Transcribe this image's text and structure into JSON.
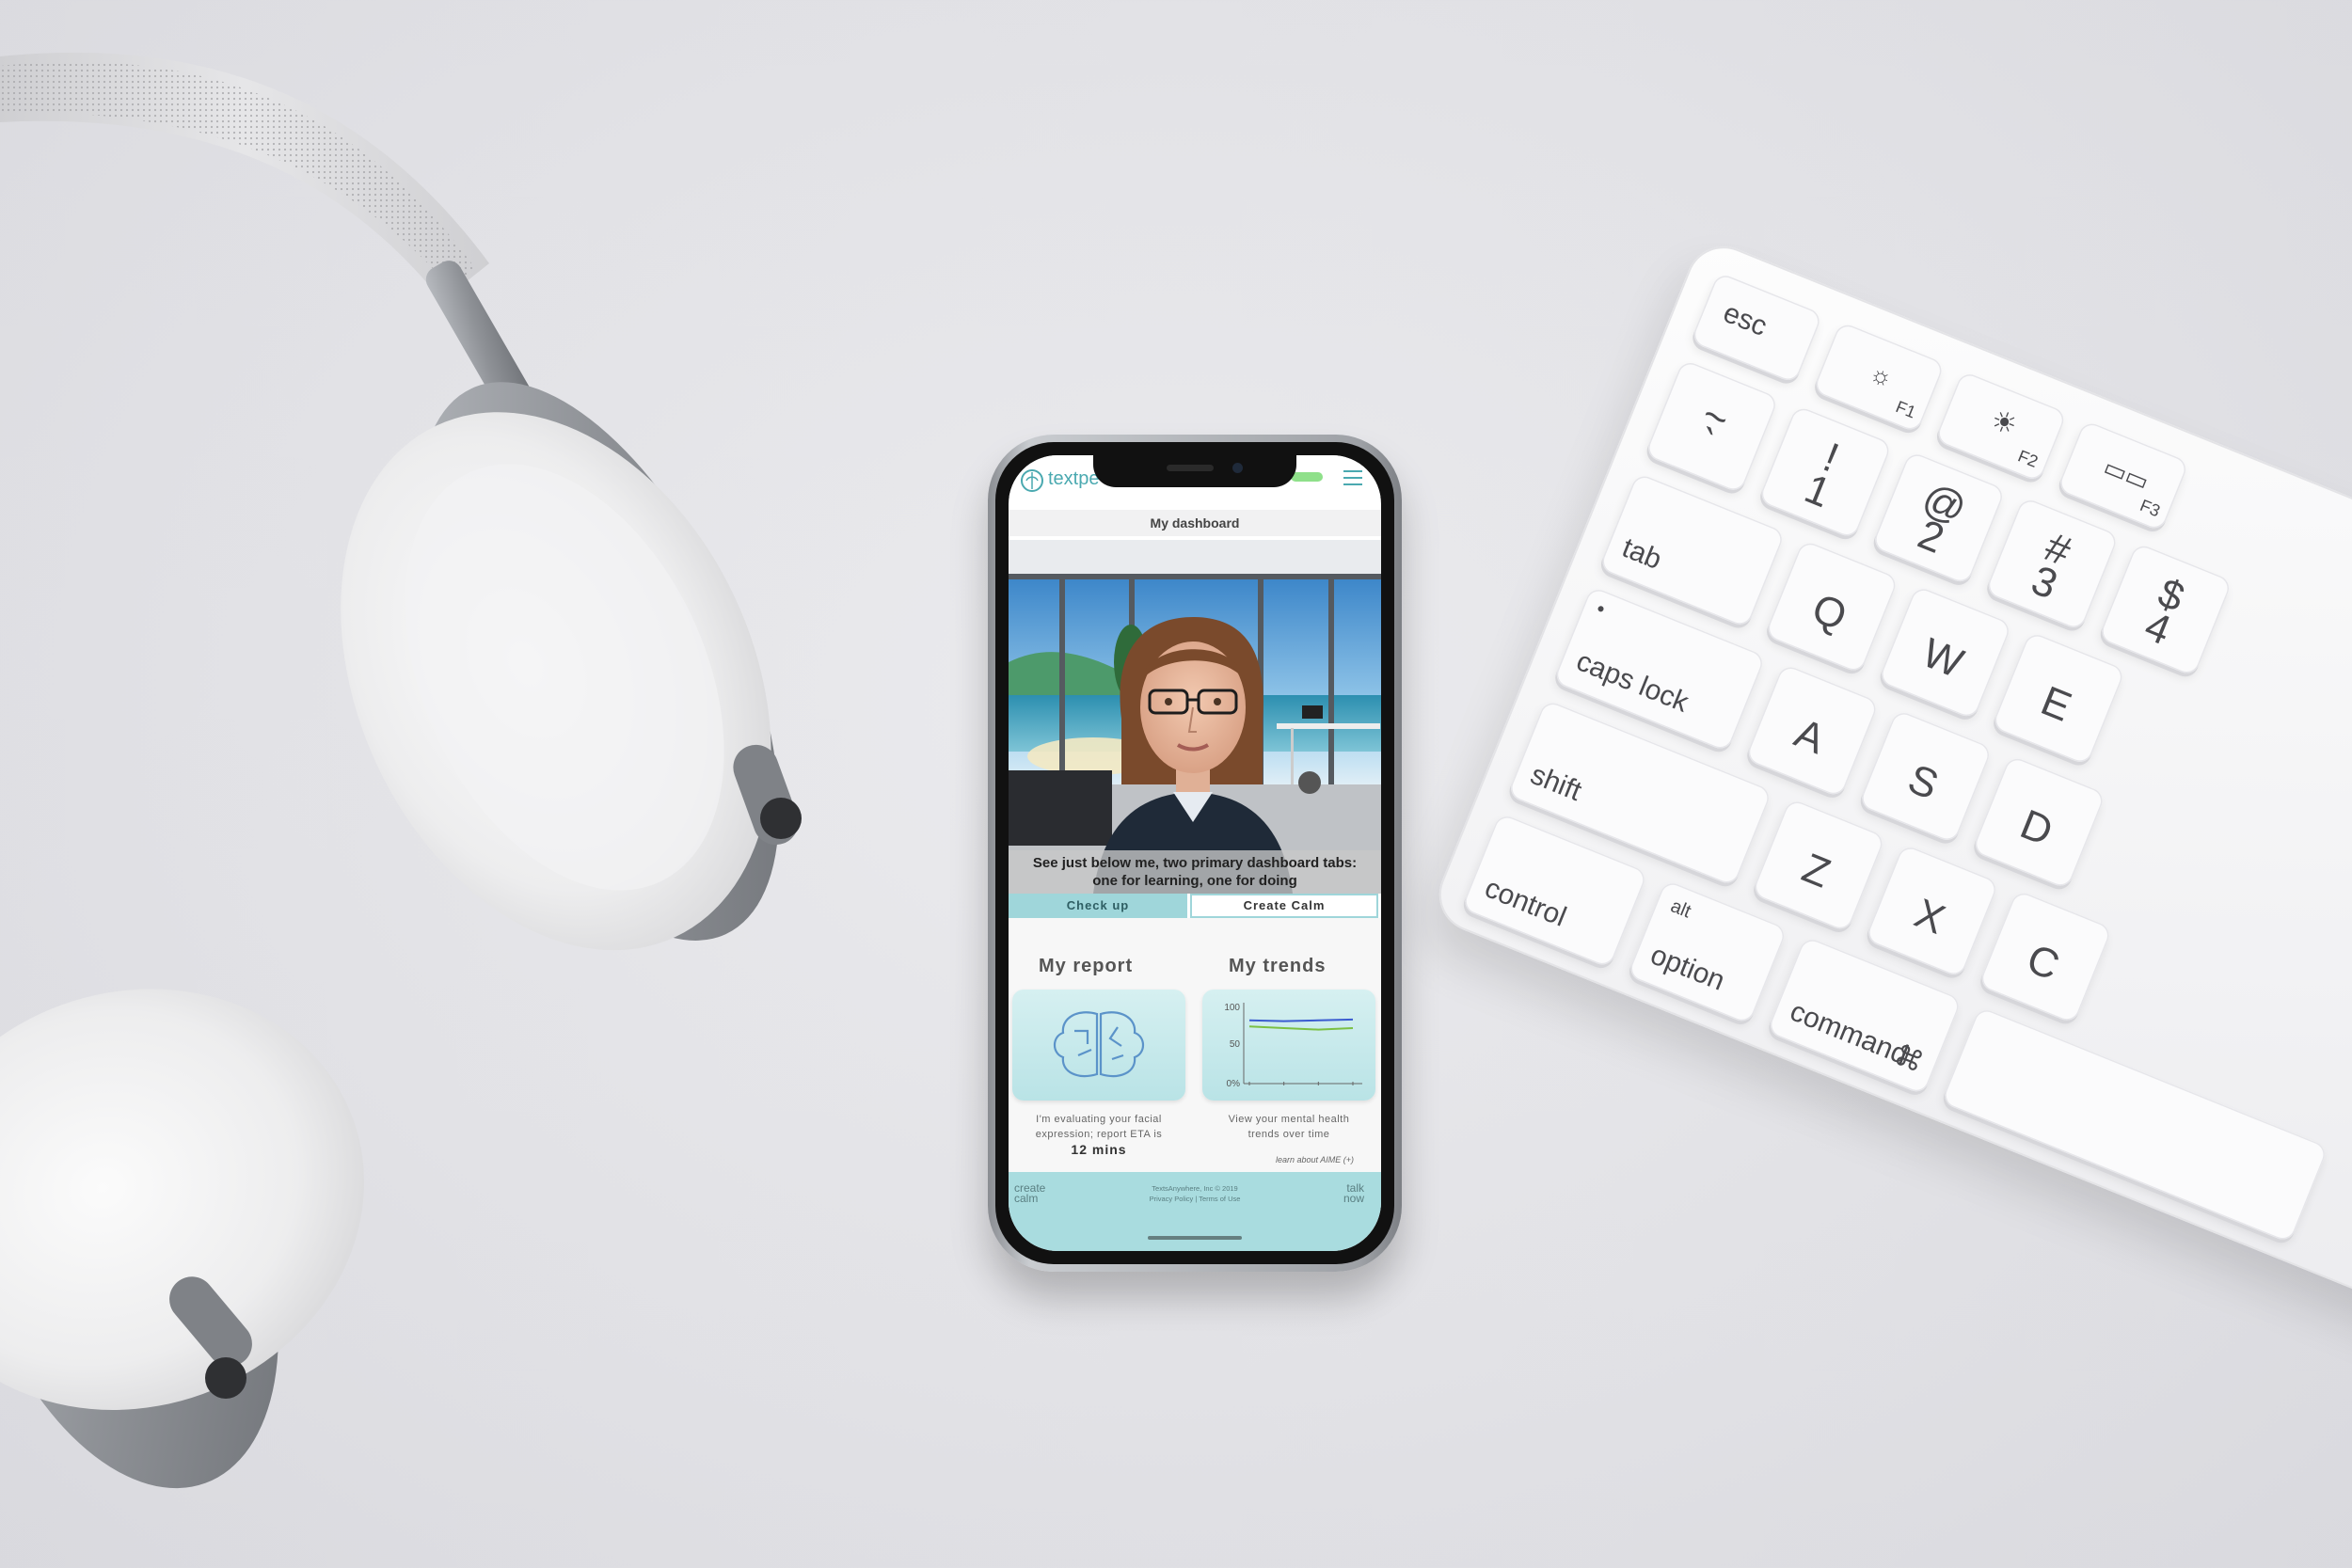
{
  "app": {
    "brand": "textpe",
    "header_title": "My dashboard"
  },
  "scene": {
    "caption_line1": "See just below me, two primary dashboard tabs:",
    "caption_line2": "one for learning, one for doing"
  },
  "tabs": [
    {
      "label": "Check up"
    },
    {
      "label": "Create Calm"
    }
  ],
  "report": {
    "title": "My report",
    "text_line1": "I'm evaluating your facial",
    "text_line2": "expression; report ETA is",
    "eta": "12 mins"
  },
  "trends": {
    "title": "My trends",
    "text_line1": "View your mental health",
    "text_line2": "trends over time",
    "chart_data": {
      "type": "line",
      "ylim": [
        0,
        100
      ],
      "yticks": [
        "100",
        "50",
        "0%"
      ],
      "series": [
        {
          "color": "#3a5bd0",
          "values": [
            82,
            81,
            82,
            83
          ]
        },
        {
          "color": "#7bc043",
          "values": [
            74,
            72,
            70,
            72
          ]
        }
      ]
    }
  },
  "learn_link": "learn about AIME (+)",
  "footer": {
    "left_line1": "create",
    "left_line2": "calm",
    "right_line1": "talk",
    "right_line2": "now",
    "legal_line1": "TextsAnywhere, Inc © 2019",
    "legal_line2": "Privacy Policy | Terms of Use"
  },
  "keyboard": {
    "keys": {
      "esc": "esc",
      "f1": "F1",
      "f2": "F2",
      "f3": "F3",
      "tilde_top": "~",
      "tilde_bot": "`",
      "k1_top": "!",
      "k1": "1",
      "k2_top": "@",
      "k2": "2",
      "k3_top": "#",
      "k3": "3",
      "k4_top": "$",
      "k4": "4",
      "tab": "tab",
      "q": "Q",
      "w": "W",
      "e": "E",
      "caps": "caps lock",
      "a": "A",
      "s": "S",
      "d": "D",
      "shift": "shift",
      "z": "Z",
      "x": "X",
      "c": "C",
      "control": "control",
      "alt": "alt",
      "option": "option",
      "command": "command",
      "cmd_symbol": "⌘"
    }
  }
}
